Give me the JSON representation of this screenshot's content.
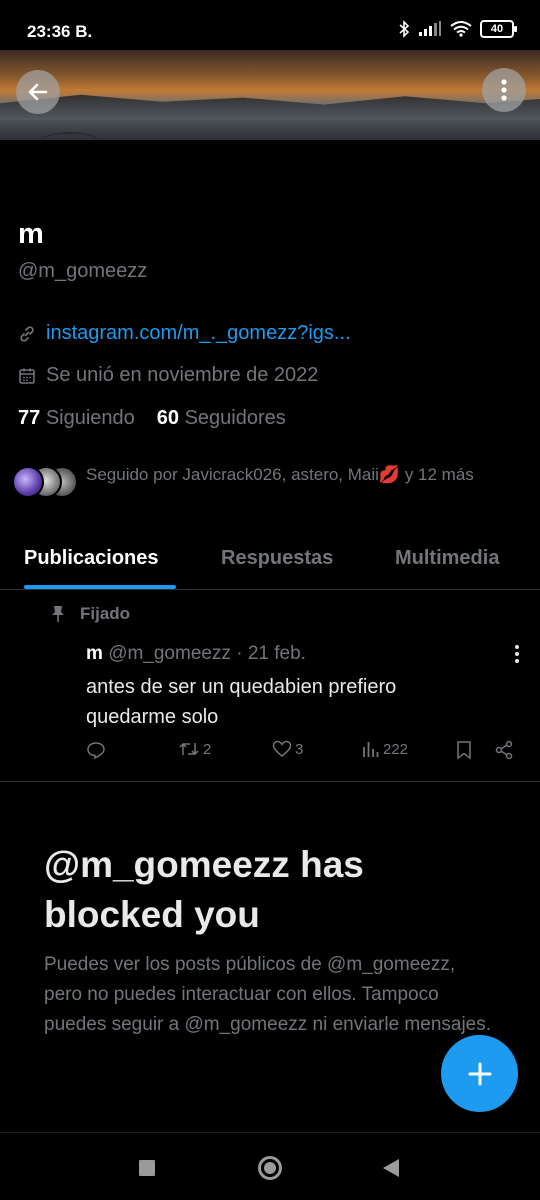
{
  "status_bar": {
    "time": "23:36",
    "carrier_glyph": "B.",
    "battery": "40",
    "icons": [
      "bluetooth-icon",
      "signal-icon",
      "wifi-icon",
      "battery-icon"
    ]
  },
  "profile": {
    "name": "m",
    "handle": "@m_gomeezz",
    "link": "instagram.com/m_._gomezz?igs...",
    "joined": "Se unió en noviembre de 2022",
    "following_count": "77",
    "following_label": "Siguiendo",
    "followers_count": "60",
    "followers_label": "Seguidores",
    "followed_by": "Seguido por Javicrack026, astero, Maii💋 y 12 más"
  },
  "tabs": [
    {
      "label": "Publicaciones",
      "active": true
    },
    {
      "label": "Respuestas",
      "active": false
    },
    {
      "label": "Multimedia",
      "active": false
    }
  ],
  "pinned_post": {
    "pinned_label": "Fijado",
    "author": "m",
    "meta": "@m_gomeezz · 21 feb.",
    "text": "antes de ser un quedabien prefiero quedarme solo",
    "retweets": "2",
    "likes": "3",
    "views": "222"
  },
  "blocked": {
    "title": "@m_gomeezz has blocked you",
    "description": "Puedes ver los posts públicos de @m_gomeezz, pero no puedes interactuar con ellos. Tampoco puedes seguir a @m_gomeezz ni enviarle mensajes."
  },
  "colors": {
    "accent": "#1d9bf0",
    "background": "#000000",
    "muted_text": "#71767b",
    "primary_text": "#e7e9ea"
  }
}
